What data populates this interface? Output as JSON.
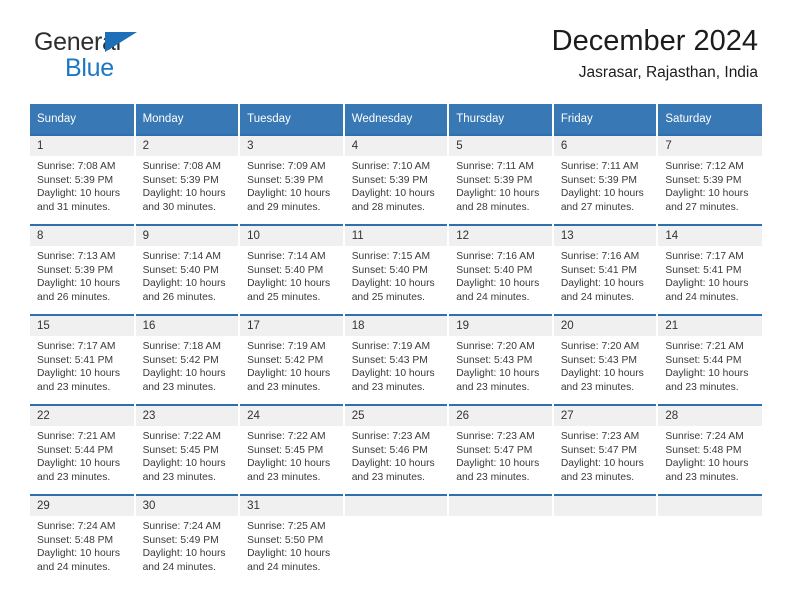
{
  "brand": {
    "name_part1": "General",
    "name_part2": "Blue",
    "triangle_color": "#1d6fb7",
    "text_color": "#2e2e2e",
    "blue_text_color": "#1d77c4"
  },
  "header": {
    "title": "December 2024",
    "subtitle": "Jasrasar, Rajasthan, India"
  },
  "theme": {
    "header_bg": "#3878b4",
    "row_rule": "#2f6fad",
    "daynum_bg": "#f0f0f0"
  },
  "weekday_headers": [
    "Sunday",
    "Monday",
    "Tuesday",
    "Wednesday",
    "Thursday",
    "Friday",
    "Saturday"
  ],
  "weeks": [
    [
      {
        "day": "1",
        "sunrise": "Sunrise: 7:08 AM",
        "sunset": "Sunset: 5:39 PM",
        "daylight1": "Daylight: 10 hours",
        "daylight2": "and 31 minutes."
      },
      {
        "day": "2",
        "sunrise": "Sunrise: 7:08 AM",
        "sunset": "Sunset: 5:39 PM",
        "daylight1": "Daylight: 10 hours",
        "daylight2": "and 30 minutes."
      },
      {
        "day": "3",
        "sunrise": "Sunrise: 7:09 AM",
        "sunset": "Sunset: 5:39 PM",
        "daylight1": "Daylight: 10 hours",
        "daylight2": "and 29 minutes."
      },
      {
        "day": "4",
        "sunrise": "Sunrise: 7:10 AM",
        "sunset": "Sunset: 5:39 PM",
        "daylight1": "Daylight: 10 hours",
        "daylight2": "and 28 minutes."
      },
      {
        "day": "5",
        "sunrise": "Sunrise: 7:11 AM",
        "sunset": "Sunset: 5:39 PM",
        "daylight1": "Daylight: 10 hours",
        "daylight2": "and 28 minutes."
      },
      {
        "day": "6",
        "sunrise": "Sunrise: 7:11 AM",
        "sunset": "Sunset: 5:39 PM",
        "daylight1": "Daylight: 10 hours",
        "daylight2": "and 27 minutes."
      },
      {
        "day": "7",
        "sunrise": "Sunrise: 7:12 AM",
        "sunset": "Sunset: 5:39 PM",
        "daylight1": "Daylight: 10 hours",
        "daylight2": "and 27 minutes."
      }
    ],
    [
      {
        "day": "8",
        "sunrise": "Sunrise: 7:13 AM",
        "sunset": "Sunset: 5:39 PM",
        "daylight1": "Daylight: 10 hours",
        "daylight2": "and 26 minutes."
      },
      {
        "day": "9",
        "sunrise": "Sunrise: 7:14 AM",
        "sunset": "Sunset: 5:40 PM",
        "daylight1": "Daylight: 10 hours",
        "daylight2": "and 26 minutes."
      },
      {
        "day": "10",
        "sunrise": "Sunrise: 7:14 AM",
        "sunset": "Sunset: 5:40 PM",
        "daylight1": "Daylight: 10 hours",
        "daylight2": "and 25 minutes."
      },
      {
        "day": "11",
        "sunrise": "Sunrise: 7:15 AM",
        "sunset": "Sunset: 5:40 PM",
        "daylight1": "Daylight: 10 hours",
        "daylight2": "and 25 minutes."
      },
      {
        "day": "12",
        "sunrise": "Sunrise: 7:16 AM",
        "sunset": "Sunset: 5:40 PM",
        "daylight1": "Daylight: 10 hours",
        "daylight2": "and 24 minutes."
      },
      {
        "day": "13",
        "sunrise": "Sunrise: 7:16 AM",
        "sunset": "Sunset: 5:41 PM",
        "daylight1": "Daylight: 10 hours",
        "daylight2": "and 24 minutes."
      },
      {
        "day": "14",
        "sunrise": "Sunrise: 7:17 AM",
        "sunset": "Sunset: 5:41 PM",
        "daylight1": "Daylight: 10 hours",
        "daylight2": "and 24 minutes."
      }
    ],
    [
      {
        "day": "15",
        "sunrise": "Sunrise: 7:17 AM",
        "sunset": "Sunset: 5:41 PM",
        "daylight1": "Daylight: 10 hours",
        "daylight2": "and 23 minutes."
      },
      {
        "day": "16",
        "sunrise": "Sunrise: 7:18 AM",
        "sunset": "Sunset: 5:42 PM",
        "daylight1": "Daylight: 10 hours",
        "daylight2": "and 23 minutes."
      },
      {
        "day": "17",
        "sunrise": "Sunrise: 7:19 AM",
        "sunset": "Sunset: 5:42 PM",
        "daylight1": "Daylight: 10 hours",
        "daylight2": "and 23 minutes."
      },
      {
        "day": "18",
        "sunrise": "Sunrise: 7:19 AM",
        "sunset": "Sunset: 5:43 PM",
        "daylight1": "Daylight: 10 hours",
        "daylight2": "and 23 minutes."
      },
      {
        "day": "19",
        "sunrise": "Sunrise: 7:20 AM",
        "sunset": "Sunset: 5:43 PM",
        "daylight1": "Daylight: 10 hours",
        "daylight2": "and 23 minutes."
      },
      {
        "day": "20",
        "sunrise": "Sunrise: 7:20 AM",
        "sunset": "Sunset: 5:43 PM",
        "daylight1": "Daylight: 10 hours",
        "daylight2": "and 23 minutes."
      },
      {
        "day": "21",
        "sunrise": "Sunrise: 7:21 AM",
        "sunset": "Sunset: 5:44 PM",
        "daylight1": "Daylight: 10 hours",
        "daylight2": "and 23 minutes."
      }
    ],
    [
      {
        "day": "22",
        "sunrise": "Sunrise: 7:21 AM",
        "sunset": "Sunset: 5:44 PM",
        "daylight1": "Daylight: 10 hours",
        "daylight2": "and 23 minutes."
      },
      {
        "day": "23",
        "sunrise": "Sunrise: 7:22 AM",
        "sunset": "Sunset: 5:45 PM",
        "daylight1": "Daylight: 10 hours",
        "daylight2": "and 23 minutes."
      },
      {
        "day": "24",
        "sunrise": "Sunrise: 7:22 AM",
        "sunset": "Sunset: 5:45 PM",
        "daylight1": "Daylight: 10 hours",
        "daylight2": "and 23 minutes."
      },
      {
        "day": "25",
        "sunrise": "Sunrise: 7:23 AM",
        "sunset": "Sunset: 5:46 PM",
        "daylight1": "Daylight: 10 hours",
        "daylight2": "and 23 minutes."
      },
      {
        "day": "26",
        "sunrise": "Sunrise: 7:23 AM",
        "sunset": "Sunset: 5:47 PM",
        "daylight1": "Daylight: 10 hours",
        "daylight2": "and 23 minutes."
      },
      {
        "day": "27",
        "sunrise": "Sunrise: 7:23 AM",
        "sunset": "Sunset: 5:47 PM",
        "daylight1": "Daylight: 10 hours",
        "daylight2": "and 23 minutes."
      },
      {
        "day": "28",
        "sunrise": "Sunrise: 7:24 AM",
        "sunset": "Sunset: 5:48 PM",
        "daylight1": "Daylight: 10 hours",
        "daylight2": "and 23 minutes."
      }
    ],
    [
      {
        "day": "29",
        "sunrise": "Sunrise: 7:24 AM",
        "sunset": "Sunset: 5:48 PM",
        "daylight1": "Daylight: 10 hours",
        "daylight2": "and 24 minutes."
      },
      {
        "day": "30",
        "sunrise": "Sunrise: 7:24 AM",
        "sunset": "Sunset: 5:49 PM",
        "daylight1": "Daylight: 10 hours",
        "daylight2": "and 24 minutes."
      },
      {
        "day": "31",
        "sunrise": "Sunrise: 7:25 AM",
        "sunset": "Sunset: 5:50 PM",
        "daylight1": "Daylight: 10 hours",
        "daylight2": "and 24 minutes."
      },
      {
        "day": "",
        "sunrise": "",
        "sunset": "",
        "daylight1": "",
        "daylight2": ""
      },
      {
        "day": "",
        "sunrise": "",
        "sunset": "",
        "daylight1": "",
        "daylight2": ""
      },
      {
        "day": "",
        "sunrise": "",
        "sunset": "",
        "daylight1": "",
        "daylight2": ""
      },
      {
        "day": "",
        "sunrise": "",
        "sunset": "",
        "daylight1": "",
        "daylight2": ""
      }
    ]
  ]
}
